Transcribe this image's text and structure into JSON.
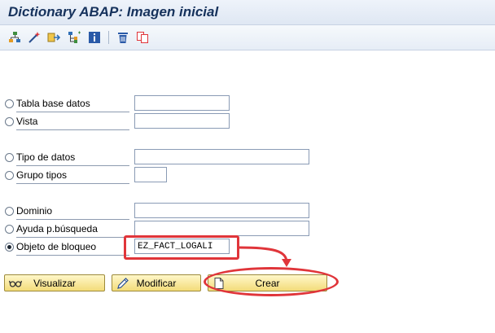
{
  "window": {
    "title": "Dictionary ABAP: Imagen inicial"
  },
  "toolbar": {
    "buttons": [
      {
        "icon": "hierarchy-icon"
      },
      {
        "icon": "magic-wand-icon"
      },
      {
        "icon": "where-used-icon"
      },
      {
        "icon": "object-tree-icon"
      },
      {
        "icon": "info-icon"
      },
      {
        "icon": "trash-icon"
      },
      {
        "icon": "copy-icon"
      }
    ]
  },
  "form": {
    "options": [
      {
        "label": "Tabla base datos",
        "selected": false,
        "value": ""
      },
      {
        "label": "Vista",
        "selected": false,
        "value": ""
      },
      {
        "label": "Tipo de datos",
        "selected": false,
        "value": ""
      },
      {
        "label": "Grupo tipos",
        "selected": false,
        "value": ""
      },
      {
        "label": "Dominio",
        "selected": false,
        "value": ""
      },
      {
        "label": "Ayuda p.búsqueda",
        "selected": false,
        "value": ""
      },
      {
        "label": "Objeto de bloqueo",
        "selected": true,
        "value": "EZ_FACT_LOGALI"
      }
    ]
  },
  "actions": {
    "display_label": "Visualizar",
    "change_label": "Modificar",
    "create_label": "Crear"
  },
  "colors": {
    "highlight": "#e0353a",
    "button_fill": "#f3dc7a",
    "title_text": "#16325c"
  }
}
